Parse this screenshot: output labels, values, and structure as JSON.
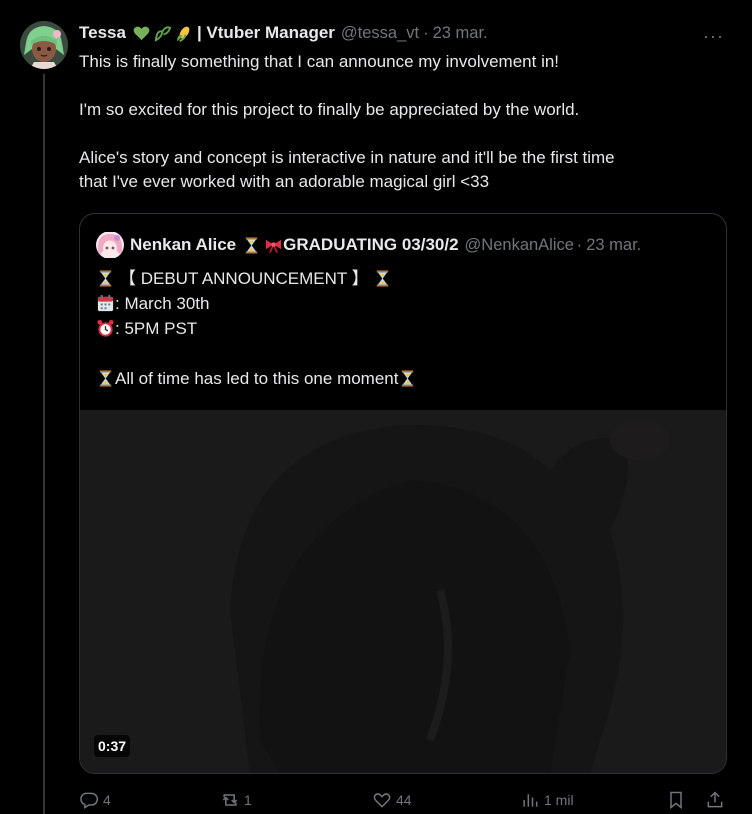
{
  "author": {
    "display_name": "Tessa",
    "role_text": "| Vtuber Manager",
    "handle": "@tessa_vt",
    "separator": "·",
    "date": "23 mar.",
    "emoji_icons": [
      "green-heart-icon",
      "sprout-icon",
      "corn-icon"
    ]
  },
  "more_label": "···",
  "tweet_text": {
    "line1": "This is finally something that I can announce my involvement in!",
    "line2": "I'm so excited for this project to finally be appreciated by the world.",
    "line3a": "Alice's story and concept is interactive in nature and it'll be the first time",
    "line3b": "that I've ever worked with an adorable magical girl <33"
  },
  "quote": {
    "display_name": "Nenkan Alice",
    "graduating_text": "GRADUATING 03/30/2",
    "handle": "@NenkanAlice",
    "separator": "·",
    "date": "23 mar.",
    "line1": "【 DEBUT ANNOUNCEMENT 】",
    "line2": ": March 30th",
    "line3": ": 5PM PST",
    "line4": "All of time has led to this one moment",
    "video_duration": "0:37"
  },
  "actions": {
    "replies": "4",
    "reposts": "1",
    "likes": "44",
    "views": "1 mil"
  },
  "colors": {
    "background": "#000000",
    "text": "#e7e9ea",
    "muted": "#71767b",
    "border": "#2f3336"
  }
}
